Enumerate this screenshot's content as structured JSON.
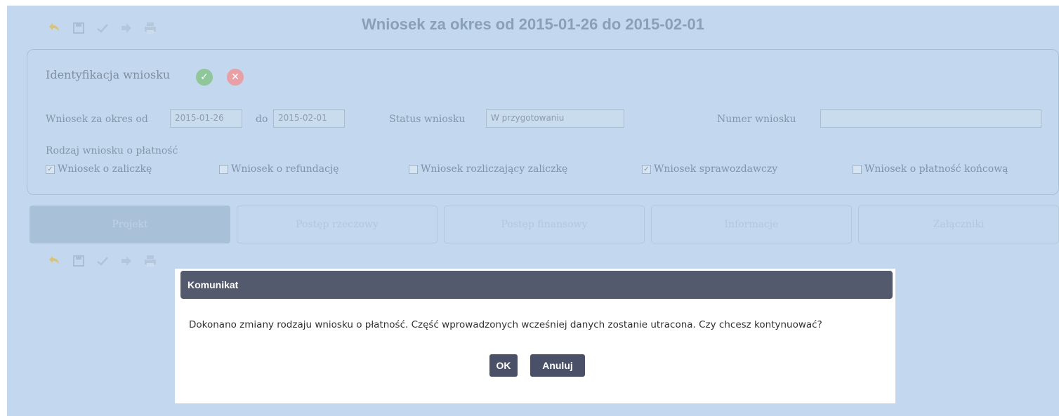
{
  "window": {
    "title": "Wniosek za okres od 2015-01-26 do 2015-02-01"
  },
  "toolbar_icons": [
    "undo-icon",
    "save-icon",
    "check-icon",
    "forward-icon",
    "print-icon"
  ],
  "identification": {
    "section_title": "Identyfikacja wniosku",
    "period_from_label": "Wniosek za okres od",
    "period_from_value": "2015-01-26",
    "period_to_label": "do",
    "period_to_value": "2015-02-01",
    "status_label": "Status wniosku",
    "status_value": "W przygotowaniu",
    "number_label": "Numer wniosku",
    "number_value": "",
    "type_label": "Rodzaj wniosku o płatność",
    "types": [
      {
        "label": "Wniosek o zaliczkę",
        "checked": true
      },
      {
        "label": "Wniosek o refundację",
        "checked": false
      },
      {
        "label": "Wniosek rozliczający zaliczkę",
        "checked": false
      },
      {
        "label": "Wniosek sprawozdawczy",
        "checked": true
      },
      {
        "label": "Wniosek o płatność końcową",
        "checked": false
      }
    ]
  },
  "tabs": [
    {
      "label": "Projekt",
      "active": true
    },
    {
      "label": "Postęp rzeczowy",
      "active": false
    },
    {
      "label": "Postęp finansowy",
      "active": false
    },
    {
      "label": "Informacje",
      "active": false
    },
    {
      "label": "Załączniki",
      "active": false
    }
  ],
  "dialog": {
    "title": "Komunikat",
    "message": "Dokonano zmiany rodzaju wniosku o płatność. Część wprowadzonych wcześniej danych zostanie utracona. Czy chcesz kontynuować?",
    "ok_label": "OK",
    "cancel_label": "Anuluj"
  },
  "colors": {
    "background": "#c3d8ee",
    "dialog_header": "#545a6d",
    "button": "#4a5068",
    "confirm_green": "#8fc69a",
    "cancel_red": "#e8a0a6"
  }
}
